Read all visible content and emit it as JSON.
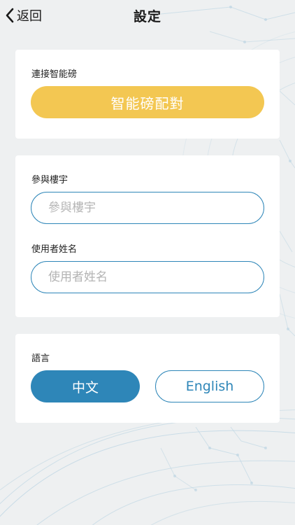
{
  "header": {
    "back_label": "返回",
    "title": "設定"
  },
  "scale_card": {
    "label": "連接智能磅",
    "pair_button": "智能磅配對"
  },
  "building_card": {
    "building_label": "參與樓宇",
    "building_placeholder": "參與樓宇",
    "building_value": "",
    "username_label": "使用者姓名",
    "username_placeholder": "使用者姓名",
    "username_value": ""
  },
  "language_card": {
    "label": "語言",
    "chinese": "中文",
    "english": "English",
    "selected": "中文"
  },
  "colors": {
    "accent_blue": "#2e86b8",
    "button_yellow": "#f3c752",
    "card_background": "#ffffff",
    "page_background": "#eef0f1"
  },
  "icons": {
    "back": "chevron-left-icon"
  }
}
